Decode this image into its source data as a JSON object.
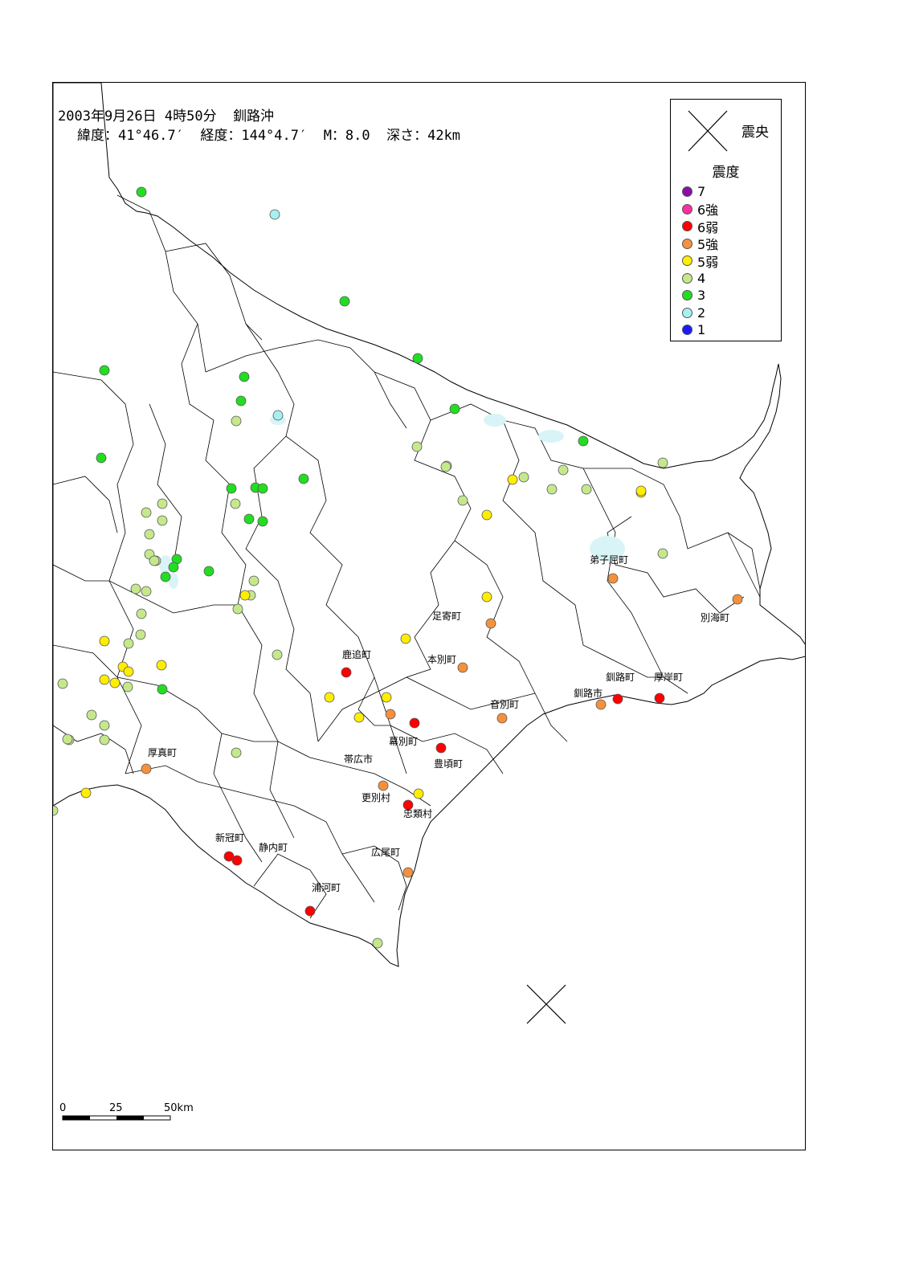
{
  "header": {
    "line1": "2003年9月26日 4時50分  釧路沖",
    "line2": "緯度：41°46.7′  経度：144°4.7′  M：8.0  深さ：42km"
  },
  "legend": {
    "epicenter_label": "震央",
    "intensity_title": "震度",
    "items": [
      {
        "label": "7",
        "color": "#8a0fa8"
      },
      {
        "label": "6強",
        "color": "#ff2ea0"
      },
      {
        "label": "6弱",
        "color": "#ff0000"
      },
      {
        "label": "5強",
        "color": "#f5913c"
      },
      {
        "label": "5弱",
        "color": "#ffee00"
      },
      {
        "label": "4",
        "color": "#c5e88c"
      },
      {
        "label": "3",
        "color": "#22dd22"
      },
      {
        "label": "2",
        "color": "#a8f0f0"
      },
      {
        "label": "1",
        "color": "#1a1aff"
      }
    ]
  },
  "towns": [
    {
      "name": "弟子屈町"
    },
    {
      "name": "足寄町"
    },
    {
      "name": "別海町"
    },
    {
      "name": "鹿追町"
    },
    {
      "name": "本別町"
    },
    {
      "name": "釧路町"
    },
    {
      "name": "厚岸町"
    },
    {
      "name": "釧路市"
    },
    {
      "name": "音別町"
    },
    {
      "name": "幕別町"
    },
    {
      "name": "帯広市"
    },
    {
      "name": "豊頃町"
    },
    {
      "name": "厚真町"
    },
    {
      "name": "更別村"
    },
    {
      "name": "忠類村"
    },
    {
      "name": "新冠町"
    },
    {
      "name": "静内町"
    },
    {
      "name": "広尾町"
    },
    {
      "name": "浦河町"
    }
  ],
  "scale": {
    "labels": [
      "0",
      "25",
      "50km"
    ]
  }
}
